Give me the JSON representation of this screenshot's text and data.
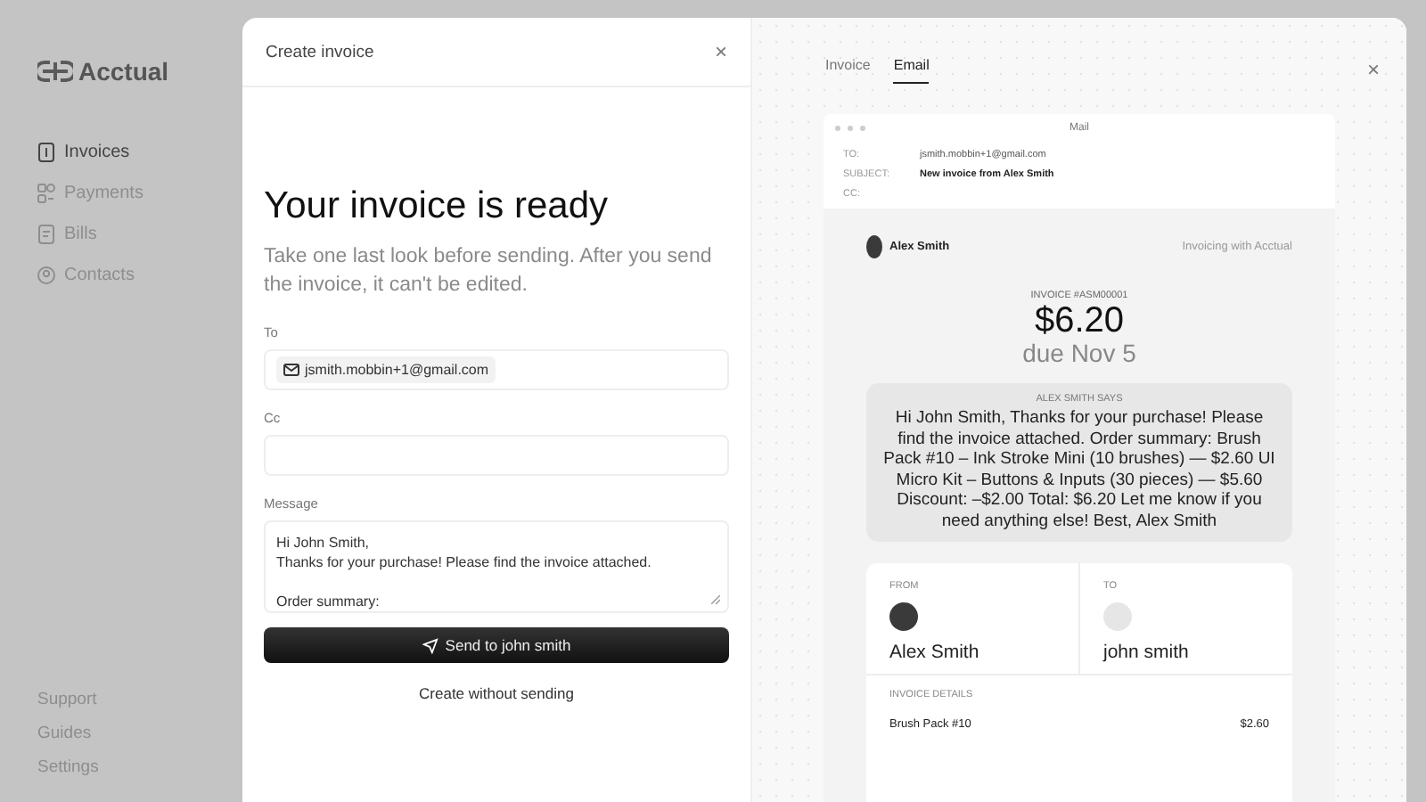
{
  "sidebar": {
    "logo": "Acctual",
    "items": [
      {
        "label": "Invoices",
        "selected": true
      },
      {
        "label": "Payments",
        "selected": false
      },
      {
        "label": "Bills",
        "selected": false
      },
      {
        "label": "Contacts",
        "selected": false
      }
    ],
    "footer_links": [
      "Support",
      "Guides",
      "Settings"
    ]
  },
  "dialog": {
    "title": "Create invoice",
    "close": "×",
    "heading": "Your invoice is ready",
    "subtitle": "Take one last look before sending. After you send the invoice, it can't be edited.",
    "to": {
      "label": "To",
      "chips": [
        "jsmith.mobbin+1@gmail.com"
      ]
    },
    "cc": {
      "label": "Cc"
    },
    "message": {
      "label": "Message",
      "value": "Hi John Smith,\nThanks for your purchase! Please find the invoice attached.\n\nOrder summary:"
    },
    "send_button": "Send to john smith",
    "secondary_button": "Create without sending"
  },
  "preview": {
    "close": "×",
    "tabs": [
      {
        "label": "Invoice",
        "selected": false
      },
      {
        "label": "Email",
        "selected": true
      }
    ],
    "mail": {
      "window_title": "Mail",
      "headers": [
        {
          "label": "TO:",
          "value": "jsmith.mobbin+1@gmail.com",
          "bold": false
        },
        {
          "label": "SUBJECT:",
          "value": "New invoice from Alex Smith",
          "bold": true
        },
        {
          "label": "CC:"
        }
      ],
      "sender": "Alex Smith",
      "brand_note": "Invoicing with Acctual",
      "invoice_number": "INVOICE #ASM00001",
      "amount": "$6.20",
      "due": "due Nov 5",
      "says_label": "ALEX SMITH SAYS",
      "says_text": "Hi John Smith, Thanks for your purchase! Please find the invoice attached. Order summary: Brush Pack #10 – Ink Stroke Mini (10 brushes) — $2.60 UI Micro Kit – Buttons & Inputs (30 pieces) — $5.60 Discount: –$2.00 Total: $6.20 Let me know if you need anything else! Best, Alex Smith",
      "from_label": "FROM",
      "from_name": "Alex Smith",
      "to_label": "TO",
      "to_name": "john smith",
      "details_label": "INVOICE DETAILS",
      "details": [
        {
          "item": "Brush Pack #10",
          "amount": "$2.60"
        }
      ]
    }
  }
}
